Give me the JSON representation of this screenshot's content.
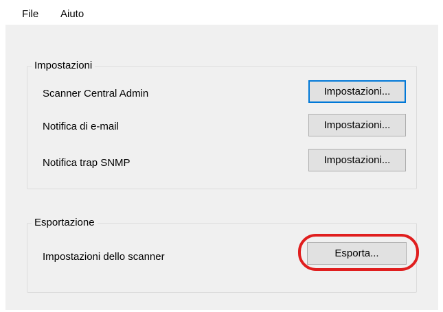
{
  "menu": {
    "items": [
      "File",
      "Aiuto"
    ]
  },
  "settings_group": {
    "title": "Impostazioni",
    "rows": [
      {
        "label": "Scanner Central Admin",
        "button": "Impostazioni..."
      },
      {
        "label": "Notifica di e-mail",
        "button": "Impostazioni..."
      },
      {
        "label": "Notifica trap SNMP",
        "button": "Impostazioni..."
      }
    ]
  },
  "export_group": {
    "title": "Esportazione",
    "rows": [
      {
        "label": "Impostazioni dello scanner",
        "button": "Esporta..."
      }
    ]
  },
  "colors": {
    "window_bg": "#f0f0f0",
    "button_bg": "#e1e1e1",
    "focus_border": "#0078d7",
    "highlight_ring": "#e01e1e"
  }
}
